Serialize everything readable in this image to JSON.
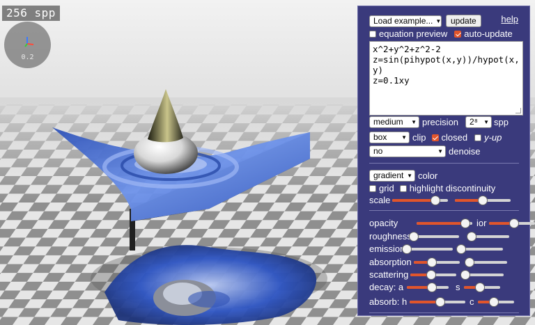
{
  "viewport": {
    "spp_label": "256 spp",
    "axis_scale": "0.2"
  },
  "colors": {
    "panel_bg": "#3a3a7c",
    "accent": "#e1552b",
    "surface_blue": "#5b7fd8"
  },
  "panel": {
    "load_example": "Load example...",
    "update_button": "update",
    "help_link": "help",
    "equation_preview": {
      "label": "equation preview",
      "checked": false
    },
    "auto_update": {
      "label": "auto-update",
      "checked": true
    },
    "equations": [
      "x^2+y^2+z^2-2",
      "z=sin(pihypot(x,y))/hypot(x,",
      "y)",
      "z=0.1xy"
    ],
    "precision": {
      "value": "medium",
      "label": "precision"
    },
    "spp": {
      "value": "2⁸",
      "label": "spp"
    },
    "clip": {
      "value": "box",
      "label": "clip"
    },
    "closed": {
      "label": "closed",
      "checked": true
    },
    "y_up": {
      "label": "y-up",
      "checked": false
    },
    "denoise": {
      "value": "no",
      "label": "denoise"
    },
    "color": {
      "value": "gradient",
      "label": "color"
    },
    "grid": {
      "label": "grid",
      "checked": false
    },
    "highlight_discontinuity": {
      "label": "highlight discontinuity",
      "checked": false
    },
    "scale": {
      "label": "scale",
      "value_a": 0.78,
      "value_b": 0.5
    },
    "sliders": {
      "opacity": {
        "label": "opacity",
        "value": 0.88
      },
      "ior": {
        "label": "ior",
        "value": 0.55
      },
      "roughness": {
        "label": "roughness",
        "value": 0.05
      },
      "roughness2": {
        "value": 0.1
      },
      "emission": {
        "label": "emission",
        "value": 0.0
      },
      "emission2": {
        "value": 0.0
      },
      "absorption": {
        "label": "absorption",
        "value": 0.4
      },
      "absorption2": {
        "value": 0.1
      },
      "scattering": {
        "label": "scattering",
        "value": 0.45
      },
      "scattering2": {
        "value": 0.08
      },
      "decay_a": {
        "label": "decay: a",
        "value": 0.6
      },
      "decay_s": {
        "label": "s",
        "value": 0.45
      },
      "absorb_h": {
        "label": "absorb: h",
        "value": 0.55
      },
      "absorb_c": {
        "label": "c",
        "value": 0.45
      }
    }
  }
}
